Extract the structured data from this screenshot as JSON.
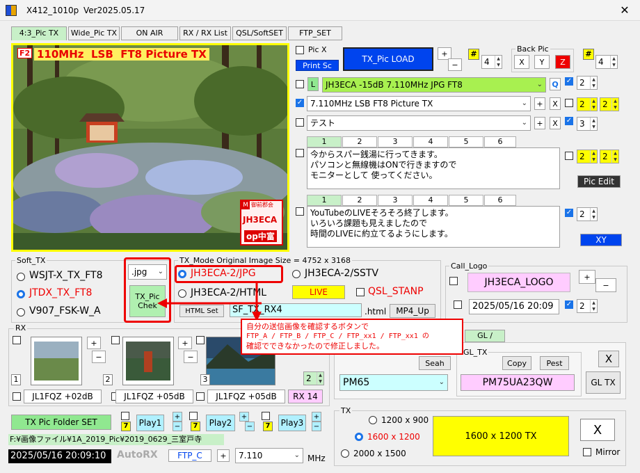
{
  "window": {
    "title": "X412_1010p",
    "version": "Ver2025.05.17"
  },
  "tabs": [
    "4:3_Pic TX",
    "Wide_Pic TX",
    "ON AIR",
    "RX / RX List",
    "QSL/SoftSET",
    "FTP_SET"
  ],
  "preview": {
    "f2_label": "F2",
    "overlay_text": "110MHz  LSB  FT8 Picture TX",
    "stamp_m": "M",
    "stamp_top": "御前郡会",
    "stamp_call": "JH3ECA",
    "stamp_op": "op中富"
  },
  "picx": {
    "label": "Pic X",
    "print": "Print Sc",
    "load": "TX_Pic  LOAD",
    "hash": "#",
    "val": "4"
  },
  "backpic": {
    "label": "Back Pic",
    "x": "X",
    "y": "Y",
    "z": "Z",
    "hash": "#",
    "val": "4"
  },
  "row1": {
    "l": "L",
    "text": "JH3ECA -15dB 7.110MHz JPG FT8",
    "q": "Q",
    "num": "2"
  },
  "row2": {
    "text": "7.110MHz LSB  FT8 Picture TX",
    "plus": "+",
    "x": "X",
    "num1": "2",
    "num2": "2"
  },
  "row3": {
    "text": "テスト",
    "plus": "+",
    "x": "X",
    "num": "3"
  },
  "memo1": {
    "tabs": [
      "1",
      "2",
      "3",
      "4",
      "5",
      "6"
    ],
    "lines": [
      "今からスパー銭湯に行ってきます。",
      "パソコンと無線機はONで行きますので",
      "モニターとして 使ってください。"
    ],
    "num1": "2",
    "num2": "2",
    "pic_edit": "Pic  Edit"
  },
  "memo2": {
    "tabs": [
      "1",
      "2",
      "3",
      "4",
      "5",
      "6"
    ],
    "lines": [
      "YouTubeのLIVEそろそろ終了します。",
      "いろいろ課題も見えましたので",
      "時間のLIVEに約立てるようにします。"
    ],
    "num": "2",
    "xy": "XY"
  },
  "soft_tx": {
    "label": "Soft_TX",
    "items": [
      "WSJT-X_TX_FT8",
      "JTDX_TX_FT8",
      "V907_FSK-W_A"
    ],
    "ext": ".jpg",
    "chek": "TX_Pic\nChek"
  },
  "tx_mode": {
    "label": "TX_Mode   Original Image  Size = 4752 x 3168",
    "jpg": "JH3ECA-2/JPG",
    "sstv": "JH3ECA-2/SSTV",
    "html": "JH3ECA-2/HTML",
    "live": "LIVE",
    "qsl": "QSL_STANP",
    "html_set": "HTML Set",
    "sf_value": "SF_TX_RX4",
    "html_ext": ".html",
    "mp4": "MP4_Up"
  },
  "call_logo": {
    "label": "Call_Logo",
    "logo": "JH3ECA_LOGO",
    "date": "2025/05/16  20:09",
    "num": "2"
  },
  "annotation": {
    "lines": [
      "自分の送信画像を確認するボタンで",
      "FTP_A / FTP_B / FTP_C / FTP_xx1 / FTP_xx1 の",
      "確認でできなかったので修正しました。"
    ]
  },
  "rx": {
    "label": "RX",
    "nums": [
      "1",
      "2",
      "3"
    ],
    "calls": [
      "JL1FQZ +02dB",
      "JL1FQZ +05dB",
      "JL1FQZ +05dB"
    ],
    "rx14": "RX 14",
    "num": "2"
  },
  "gl": {
    "tab": "GL /",
    "gl_tx_label": "GL_TX",
    "seah": "Seah",
    "pm65": "PM65",
    "copy": "Copy",
    "pest": "Pest",
    "pm75": "PM75UA23QW",
    "x": "X",
    "gltx": "GL TX"
  },
  "bottom": {
    "folder": "TX Pic  Folder SET",
    "play": [
      "Play1",
      "Play2",
      "Play3"
    ],
    "seven": "7",
    "path": "F:¥画像ファイル¥1A_2019_Pic¥2019_0629_三室戸寺",
    "datetime": "2025/05/16   20:09:10",
    "autorx": "AutoRX",
    "ftp": "FTP_C",
    "plus": "+",
    "freq": "7.110",
    "mhz": "MHz"
  },
  "tx": {
    "label": "TX",
    "sizes": [
      "1200 x 900",
      "1600 x 1200",
      "2000 x 1500"
    ],
    "main": "1600 x 1200   TX",
    "x": "X",
    "mirror": "Mirror"
  }
}
